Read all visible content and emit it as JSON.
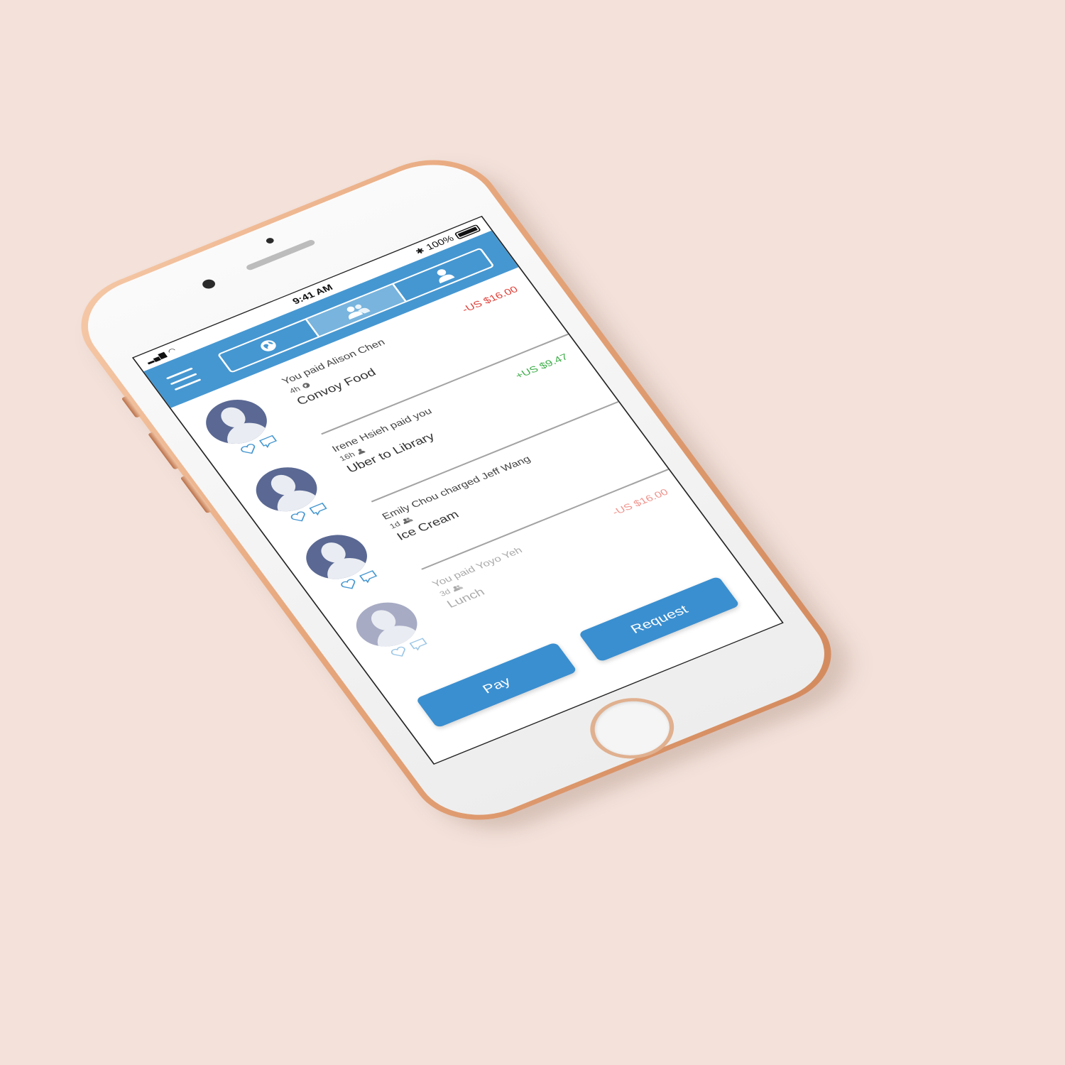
{
  "colors": {
    "background": "#f3e1da",
    "nav_bar": "#4597d1",
    "button": "#3a8fd0",
    "amount_negative": "#e0413a",
    "amount_positive": "#3fae4a",
    "icon_blue": "#4597d1"
  },
  "status_bar": {
    "time": "9:41 AM",
    "battery": "100%",
    "battery_level": 1.0,
    "icons": [
      "signal-icon",
      "wifi-icon",
      "bluetooth-icon",
      "battery-icon"
    ]
  },
  "nav": {
    "menu_icon": "hamburger-icon",
    "tabs": [
      {
        "icon": "globe-icon",
        "active": false
      },
      {
        "icon": "friends-icon",
        "active": true
      },
      {
        "icon": "person-icon",
        "active": false
      }
    ]
  },
  "feed": {
    "items": [
      {
        "title": "You paid Alison Chen",
        "time": "4h",
        "audience_icon": "globe-icon",
        "note": "Convoy Food",
        "amount": "-US $16.00",
        "amount_type": "negative"
      },
      {
        "title": "Irene Hsieh paid you",
        "time": "16h",
        "audience_icon": "person-icon",
        "note": "Uber to Library",
        "amount": "+US $9.47",
        "amount_type": "positive"
      },
      {
        "title": "Emily Chou charged Jeff Wang",
        "time": "1d",
        "audience_icon": "friends-icon",
        "note": "Ice Cream",
        "amount": "",
        "amount_type": "none"
      },
      {
        "title": "You paid Yoyo Yeh",
        "time": "3d",
        "audience_icon": "friends-icon",
        "note": "Lunch",
        "amount": "-US $16.00",
        "amount_type": "negative"
      }
    ]
  },
  "actions": {
    "pay_label": "Pay",
    "request_label": "Request"
  }
}
